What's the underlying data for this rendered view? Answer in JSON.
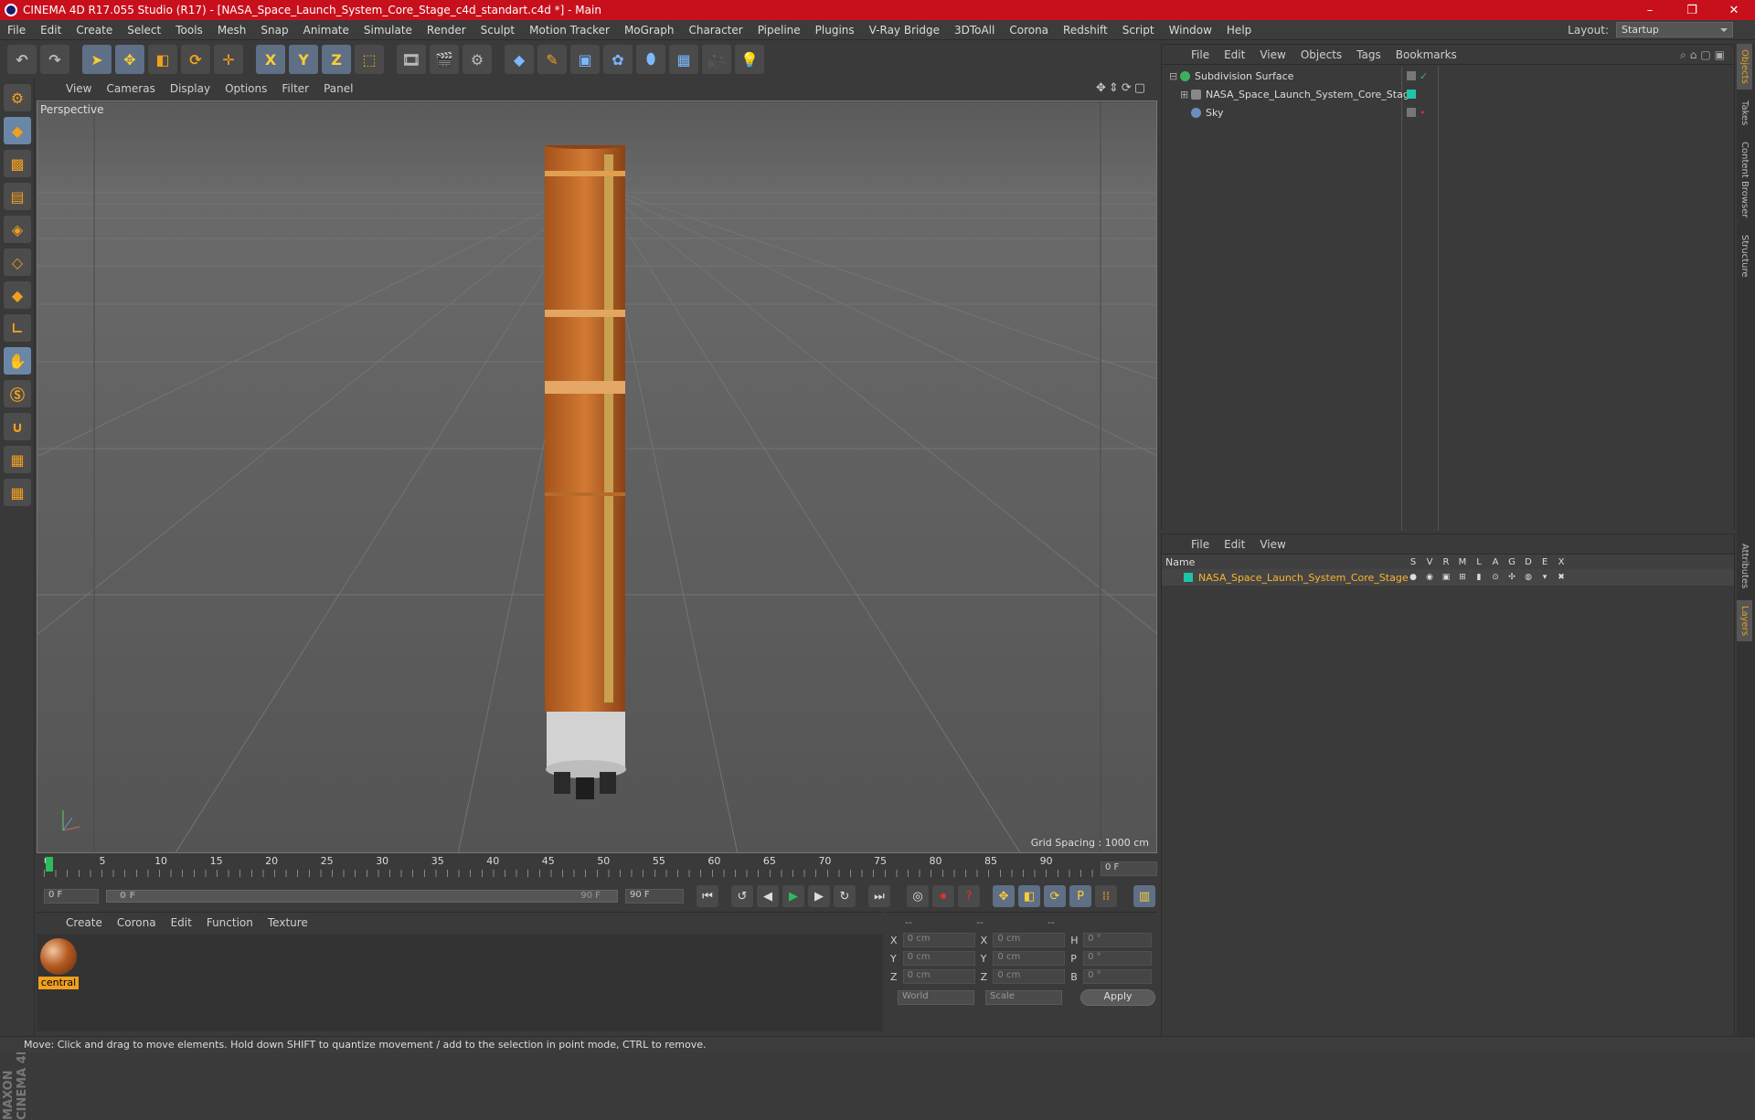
{
  "window": {
    "title": "CINEMA 4D R17.055 Studio (R17) - [NASA_Space_Launch_System_Core_Stage_c4d_standart.c4d *] - Main",
    "controls": [
      "–",
      "❐",
      "✕"
    ]
  },
  "menu": {
    "items": [
      "File",
      "Edit",
      "Create",
      "Select",
      "Tools",
      "Mesh",
      "Snap",
      "Animate",
      "Simulate",
      "Render",
      "Sculpt",
      "Motion Tracker",
      "MoGraph",
      "Character",
      "Pipeline",
      "Plugins",
      "V-Ray Bridge",
      "3DToAll",
      "Corona",
      "Redshift",
      "Script",
      "Window",
      "Help"
    ],
    "layout_label": "Layout:",
    "layout_value": "Startup"
  },
  "toolbar": {
    "icons": [
      "undo-icon",
      "redo-icon",
      "select-arrow-icon",
      "move-icon",
      "scale-icon",
      "rotate-icon",
      "move-snap-icon",
      "axis-x-icon",
      "axis-y-icon",
      "axis-z-icon",
      "coordinate-system-icon",
      "render-view-icon",
      "render-picture-viewer-icon",
      "render-settings-icon",
      "cube-icon",
      "pen-spline-icon",
      "subdivision-icon",
      "cloner-icon",
      "deformer-icon",
      "floor-icon",
      "camera-icon",
      "light-icon"
    ],
    "axis_labels": [
      "X",
      "Y",
      "Z"
    ]
  },
  "viewport": {
    "menu": [
      "View",
      "Cameras",
      "Display",
      "Options",
      "Filter",
      "Panel"
    ],
    "label": "Perspective",
    "grid_spacing": "Grid Spacing : 1000 cm"
  },
  "timeline": {
    "ticks": [
      "0",
      "5",
      "10",
      "15",
      "20",
      "25",
      "30",
      "35",
      "40",
      "45",
      "50",
      "55",
      "60",
      "65",
      "70",
      "75",
      "80",
      "85",
      "90"
    ],
    "end_field": "0 F",
    "start_frame": "0 F",
    "slider_start": "0 F",
    "slider_end": "90 F",
    "end_frame": "90 F"
  },
  "materials": {
    "menu": [
      "Create",
      "Corona",
      "Edit",
      "Function",
      "Texture"
    ],
    "items": [
      {
        "name": "central"
      }
    ]
  },
  "coordinates": {
    "headers": [
      "--",
      "--",
      "--"
    ],
    "rows": [
      {
        "a": "X",
        "v1": "0 cm",
        "b": "X",
        "v2": "0 cm",
        "c": "H",
        "v3": "0 °"
      },
      {
        "a": "Y",
        "v1": "0 cm",
        "b": "Y",
        "v2": "0 cm",
        "c": "P",
        "v3": "0 °"
      },
      {
        "a": "Z",
        "v1": "0 cm",
        "b": "Z",
        "v2": "0 cm",
        "c": "B",
        "v3": "0 °"
      }
    ],
    "mode_world": "World",
    "mode_scale": "Scale",
    "apply": "Apply"
  },
  "objects_panel": {
    "menu": [
      "File",
      "Edit",
      "View",
      "Objects",
      "Tags",
      "Bookmarks"
    ],
    "items": [
      {
        "name": "Subdivision Surface"
      },
      {
        "name": "NASA_Space_Launch_System_Core_Stage"
      },
      {
        "name": "Sky"
      }
    ]
  },
  "layers_panel": {
    "menu": [
      "File",
      "Edit",
      "View"
    ],
    "header_name": "Name",
    "columns": [
      "S",
      "V",
      "R",
      "M",
      "L",
      "A",
      "G",
      "D",
      "E",
      "X"
    ],
    "layers": [
      {
        "name": "NASA_Space_Launch_System_Core_Stage",
        "color": "#1fc3a8"
      }
    ]
  },
  "right_tabs": [
    "Objects",
    "Takes",
    "Content Browser",
    "Structure",
    "Attributes",
    "Layers"
  ],
  "brand": "MAXON CINEMA 4D",
  "status": "Move: Click and drag to move elements. Hold down SHIFT to quantize movement / add to the selection in point mode, CTRL to remove.",
  "colors": {
    "title_bar": "#c8101d",
    "accent": "#f0a020",
    "selection": "#ffb429"
  }
}
